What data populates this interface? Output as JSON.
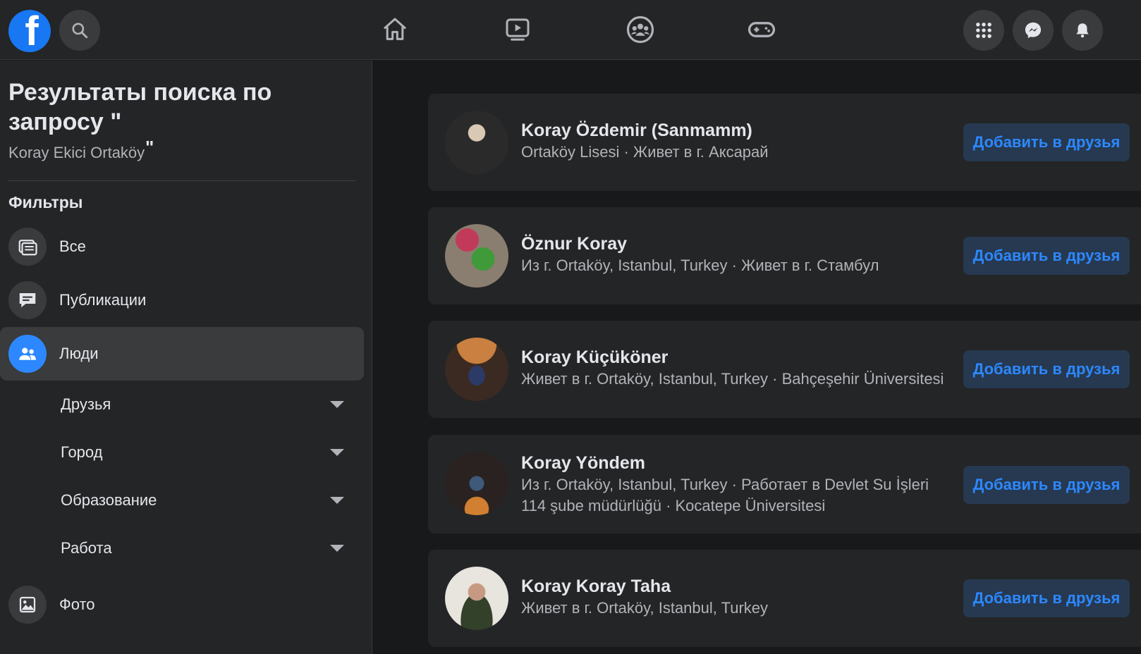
{
  "header": {
    "logo_letter": "f",
    "brand_color": "#1877f2"
  },
  "sidebar": {
    "title": "Результаты поиска по запросу \"",
    "query": "Koray Ekici Ortaköy",
    "query_close_quote": "\"",
    "filters_heading": "Фильтры",
    "items": [
      {
        "label": "Все",
        "icon": "all-results-icon"
      },
      {
        "label": "Публикации",
        "icon": "posts-icon"
      },
      {
        "label": "Люди",
        "icon": "people-icon",
        "active": true
      }
    ],
    "sub_filters": [
      {
        "label": "Друзья"
      },
      {
        "label": "Город"
      },
      {
        "label": "Образование"
      },
      {
        "label": "Работа"
      }
    ],
    "photos_item": {
      "label": "Фото",
      "icon": "photos-icon"
    }
  },
  "results": [
    {
      "name": "Koray Özdemir (Sanmamm)",
      "meta": "Ortaköy Lisesi · Живет в г. Аксарай",
      "button": "Добавить в друзья"
    },
    {
      "name": "Öznur Koray",
      "meta": "Из г. Ortaköy, Istanbul, Turkey · Живет в г. Стамбул",
      "button": "Добавить в друзья"
    },
    {
      "name": "Koray Küçüköner",
      "meta": "Живет в г. Ortaköy, Istanbul, Turkey · Bahçeşehir Üniversitesi",
      "button": "Добавить в друзья"
    },
    {
      "name": "Koray Yöndem",
      "meta": "Из г. Ortaköy, Istanbul, Turkey · Работает в Devlet Su İşleri 114 şube müdürlüğü · Kocatepe Üniversitesi",
      "button": "Добавить в друзья"
    },
    {
      "name": "Koray Koray Taha",
      "meta": "Живет в г. Ortaköy, Istanbul, Turkey",
      "button": "Добавить в друзья"
    }
  ]
}
